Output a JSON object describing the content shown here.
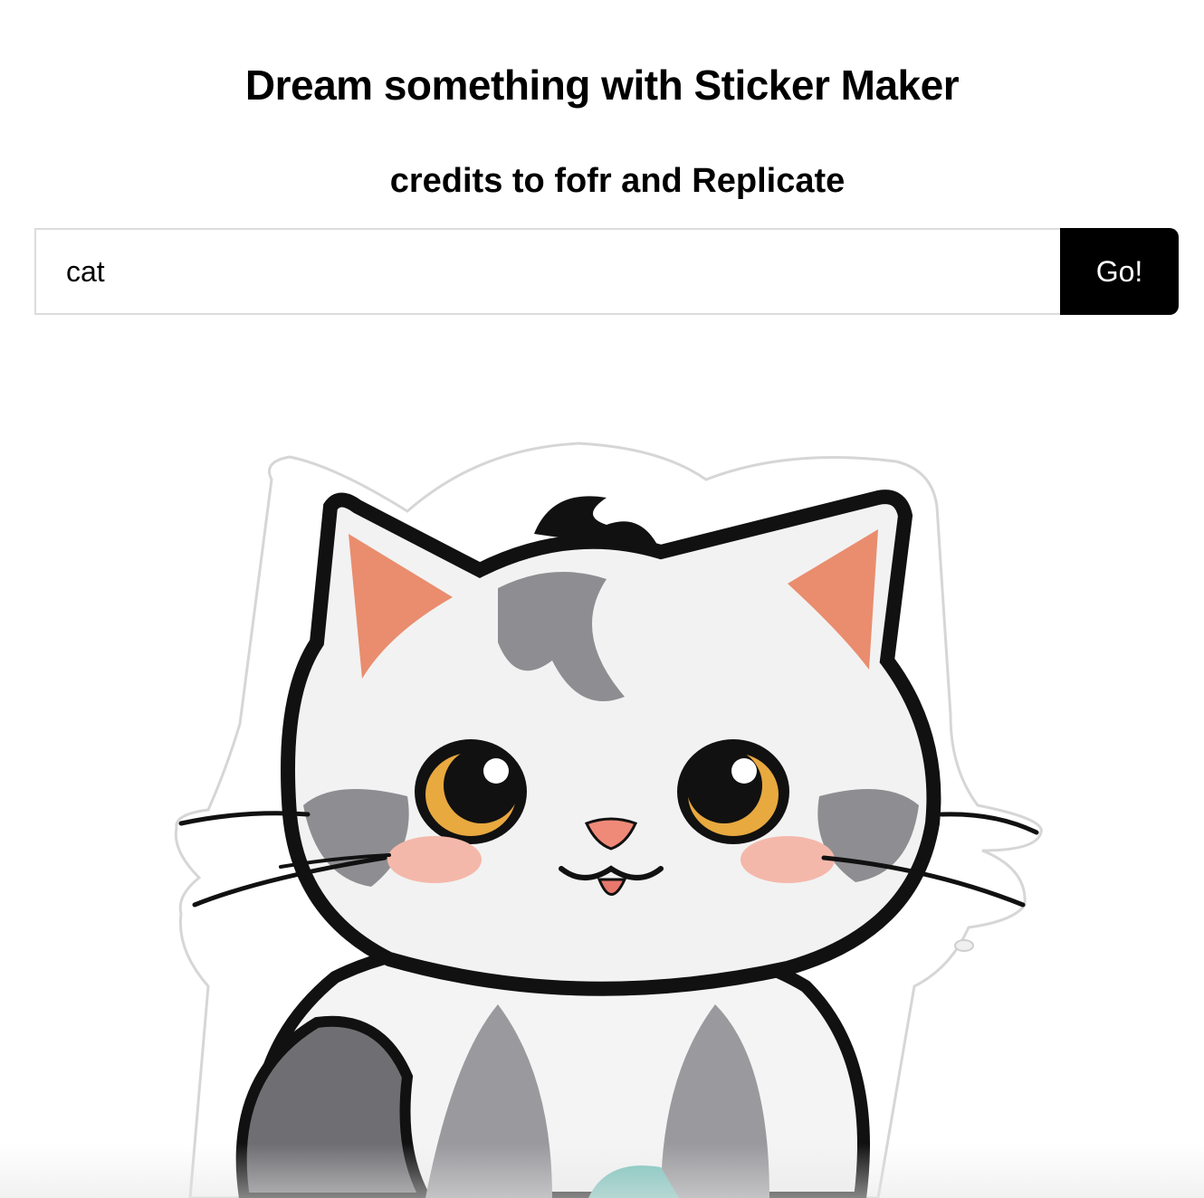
{
  "header": {
    "title": "Dream something with Sticker Maker",
    "credits": "credits to fofr and Replicate"
  },
  "prompt_form": {
    "input_value": "cat",
    "button_label": "Go!"
  },
  "result": {
    "image_subject": "cat sticker",
    "icon": "cat-sticker-illustration"
  },
  "colors": {
    "button_bg": "#000000",
    "button_text": "#ffffff",
    "input_border": "#dcdcdc",
    "ear_inner": "#e98d6e",
    "eye_iris": "#e8a93f",
    "fur_gray": "#8e8e92",
    "cheek": "#f4b8aa"
  }
}
